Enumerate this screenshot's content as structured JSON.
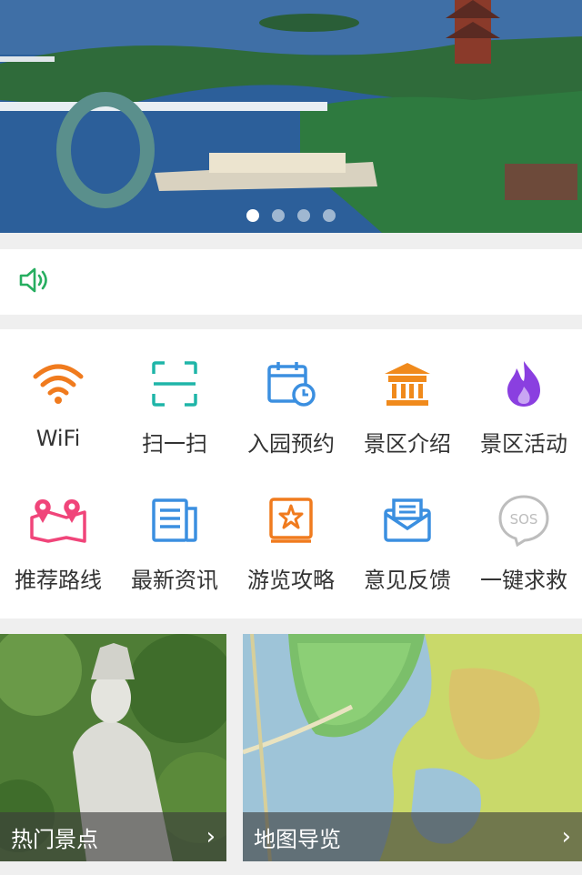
{
  "banner": {
    "slides": 4,
    "active_slide": 1
  },
  "notice": {
    "text": "",
    "icon": "speaker-icon",
    "icon_color": "#27ae60"
  },
  "grid": {
    "items": [
      {
        "label": "WiFi",
        "icon": "wifi-icon",
        "color": "#f07b1e"
      },
      {
        "label": "扫一扫",
        "icon": "scan-icon",
        "color": "#1fb5a8"
      },
      {
        "label": "入园预约",
        "icon": "calendar-clock-icon",
        "color": "#3b8fe0"
      },
      {
        "label": "景区介绍",
        "icon": "temple-icon",
        "color": "#f08a1c"
      },
      {
        "label": "景区活动",
        "icon": "flame-icon",
        "color": "#8a3fe0"
      },
      {
        "label": "推荐路线",
        "icon": "map-pin-icon",
        "color": "#f0457a"
      },
      {
        "label": "最新资讯",
        "icon": "news-icon",
        "color": "#3b8fe0"
      },
      {
        "label": "游览攻略",
        "icon": "guide-book-icon",
        "color": "#f07b1e"
      },
      {
        "label": "意见反馈",
        "icon": "mail-icon",
        "color": "#3b8fe0"
      },
      {
        "label": "一键求救",
        "icon": "sos-icon",
        "color": "#bdbdbd"
      }
    ]
  },
  "cards": [
    {
      "label": "热门景点",
      "image": "statue-photo"
    },
    {
      "label": "地图导览",
      "image": "scenic-map"
    }
  ]
}
